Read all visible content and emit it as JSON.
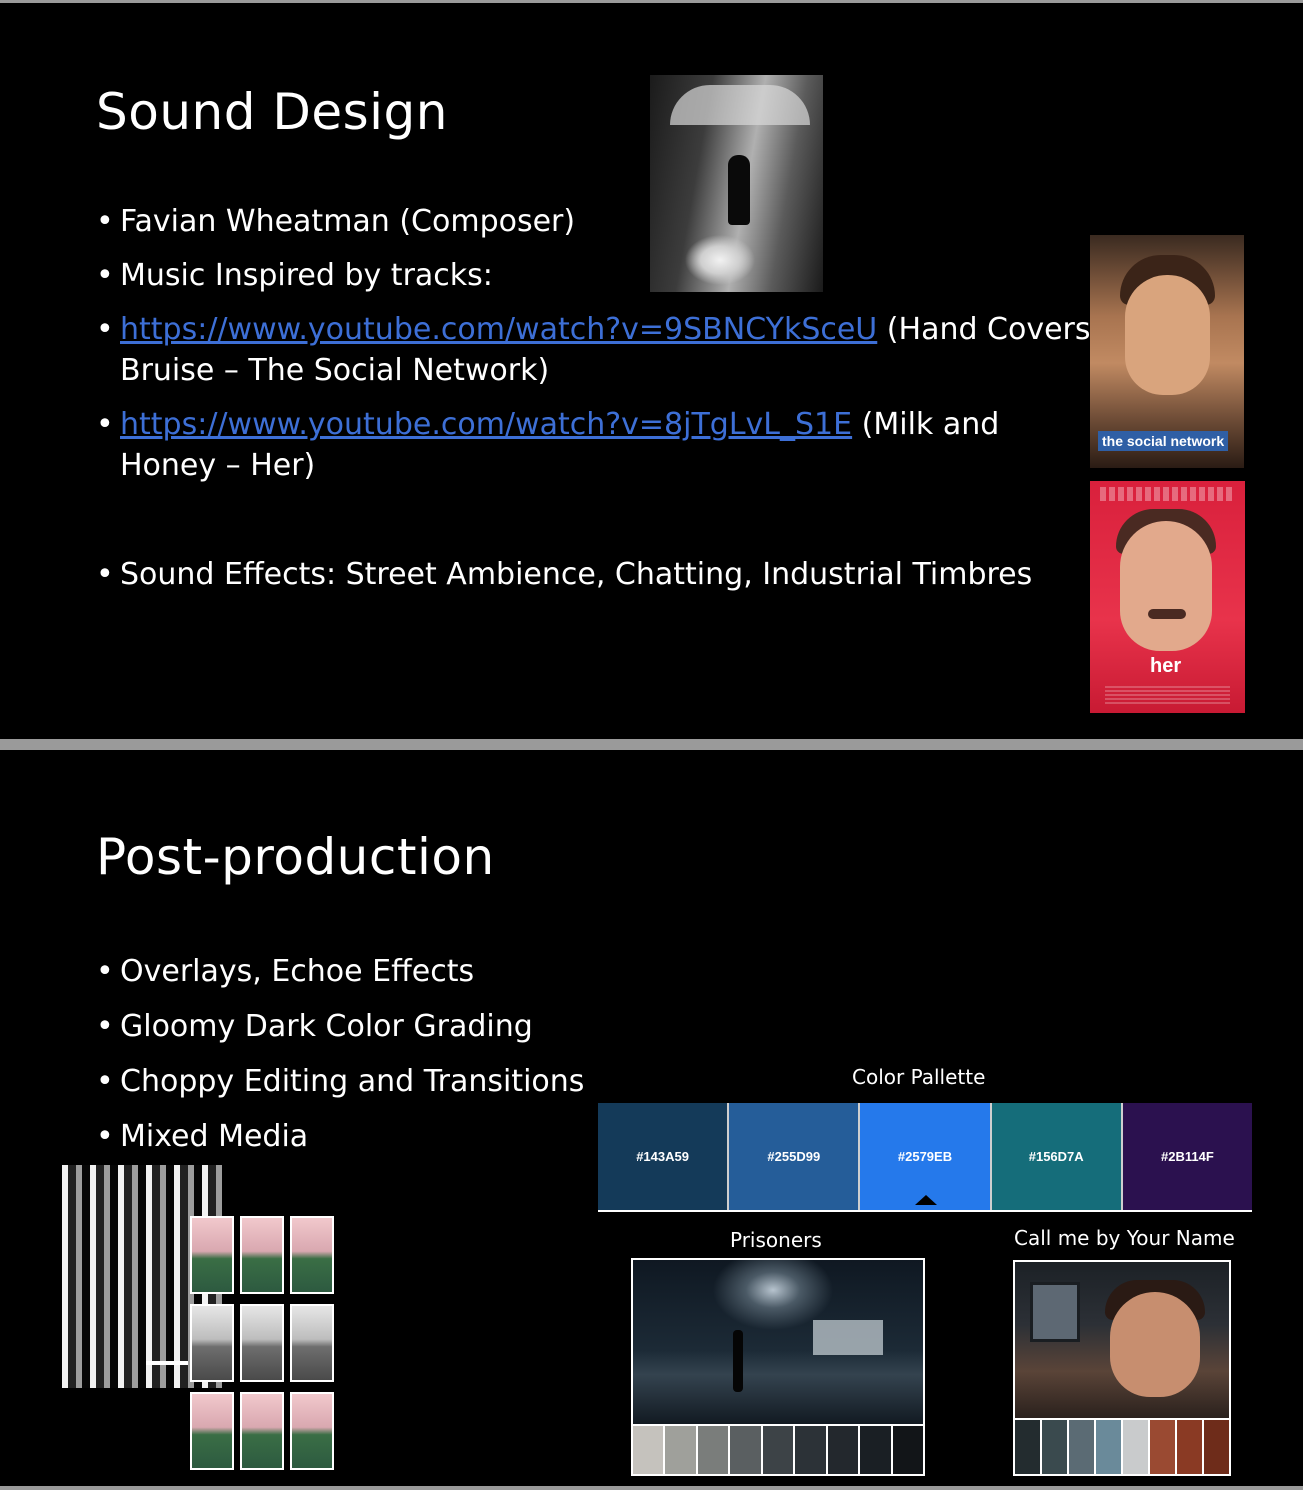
{
  "slide1": {
    "title": "Sound Design",
    "bullets": [
      {
        "text": "Favian Wheatman (Composer)"
      },
      {
        "text": "Music Inspired by tracks:"
      },
      {
        "link": "https://www.youtube.com/watch?v=9SBNCYkSceU",
        "text": " (Hand Covers Bruise – The Social Network)"
      },
      {
        "link": "https://www.youtube.com/watch?v=8jTgLvL_S1E",
        "text": " (Milk and Honey – Her)"
      },
      {
        "text": "Sound Effects: Street Ambience, Chatting, Industrial Timbres"
      }
    ],
    "posters": {
      "social_network": "the social network",
      "her": "her"
    }
  },
  "slide2": {
    "title": "Post-production",
    "bullets": [
      {
        "text": "Overlays, Echoe Effects"
      },
      {
        "text": "Gloomy Dark Color Grading"
      },
      {
        "text": "Choppy Editing and Transitions"
      },
      {
        "text": "Mixed Media"
      }
    ],
    "palette": {
      "label": "Color Pallette",
      "swatches": [
        {
          "hex": "#143A59",
          "color": "#143A59"
        },
        {
          "hex": "#255D99",
          "color": "#255D99"
        },
        {
          "hex": "#2579EB",
          "color": "#2579EB"
        },
        {
          "hex": "#156D7A",
          "color": "#156D7A"
        },
        {
          "hex": "#2B114F",
          "color": "#2B114F"
        }
      ]
    },
    "references": {
      "prisoners_label": "Prisoners",
      "cmbyn_label": "Call me by Your Name",
      "prisoners_strip": [
        "#c5c2bd",
        "#9fa09b",
        "#7a7d7b",
        "#5a5f61",
        "#3d4347",
        "#2c3237",
        "#23282d",
        "#1a1f24",
        "#121518"
      ],
      "cmbyn_strip": [
        "#232c2f",
        "#3a4a4e",
        "#5b6b74",
        "#6a8a9a",
        "#c9cbcc",
        "#9a4a32",
        "#8a3a24",
        "#6e2c1a"
      ]
    }
  }
}
